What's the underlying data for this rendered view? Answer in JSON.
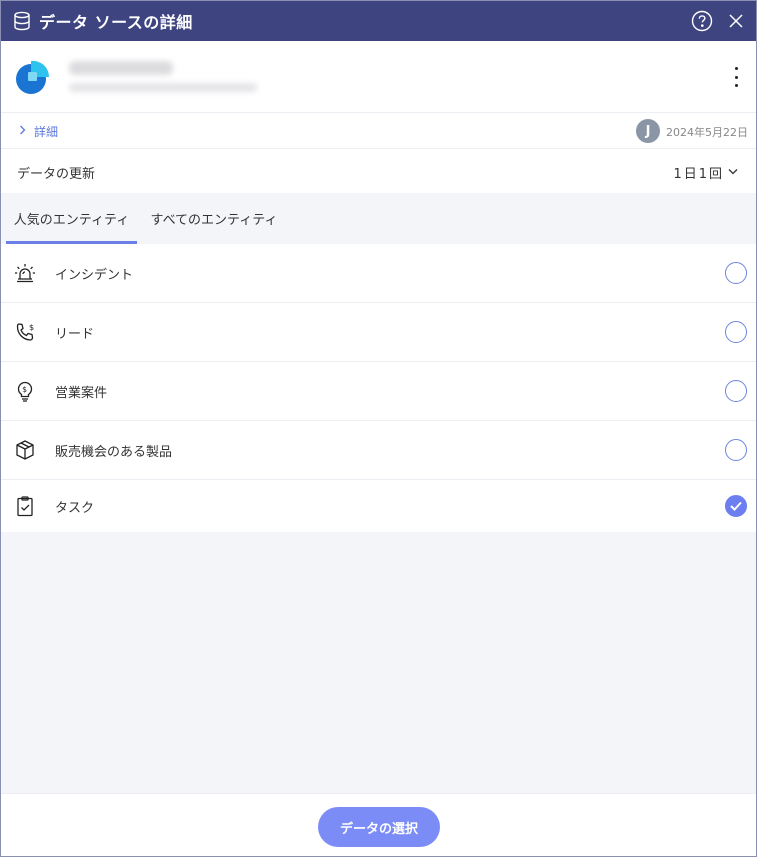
{
  "window": {
    "title": "データ ソースの詳細",
    "help_icon": "question-circle-icon",
    "close_icon": "close-icon"
  },
  "source": {
    "logo_icon": "dynamics-logo-icon",
    "more_icon": "kebab-menu-icon"
  },
  "meta": {
    "details_label": "詳細",
    "avatar_initial": "J",
    "date": "2024年5月22日"
  },
  "refresh": {
    "label": "データの更新",
    "frequency": "1日1回"
  },
  "tabs": [
    {
      "label": "人気のエンティティ",
      "active": true
    },
    {
      "label": "すべてのエンティティ",
      "active": false
    }
  ],
  "entities": [
    {
      "label": "インシデント",
      "icon": "siren-icon",
      "selected": false
    },
    {
      "label": "リード",
      "icon": "phone-dollar-icon",
      "selected": false
    },
    {
      "label": "営業案件",
      "icon": "lightbulb-dollar-icon",
      "selected": false
    },
    {
      "label": "販売機会のある製品",
      "icon": "box-icon",
      "selected": false
    },
    {
      "label": "タスク",
      "icon": "clipboard-check-icon",
      "selected": true
    }
  ],
  "footer": {
    "select_button": "データの選択"
  },
  "colors": {
    "titlebar": "#3e4480",
    "accent": "#6b7fe8",
    "button": "#7b8cf6",
    "link": "#5b77d8"
  }
}
